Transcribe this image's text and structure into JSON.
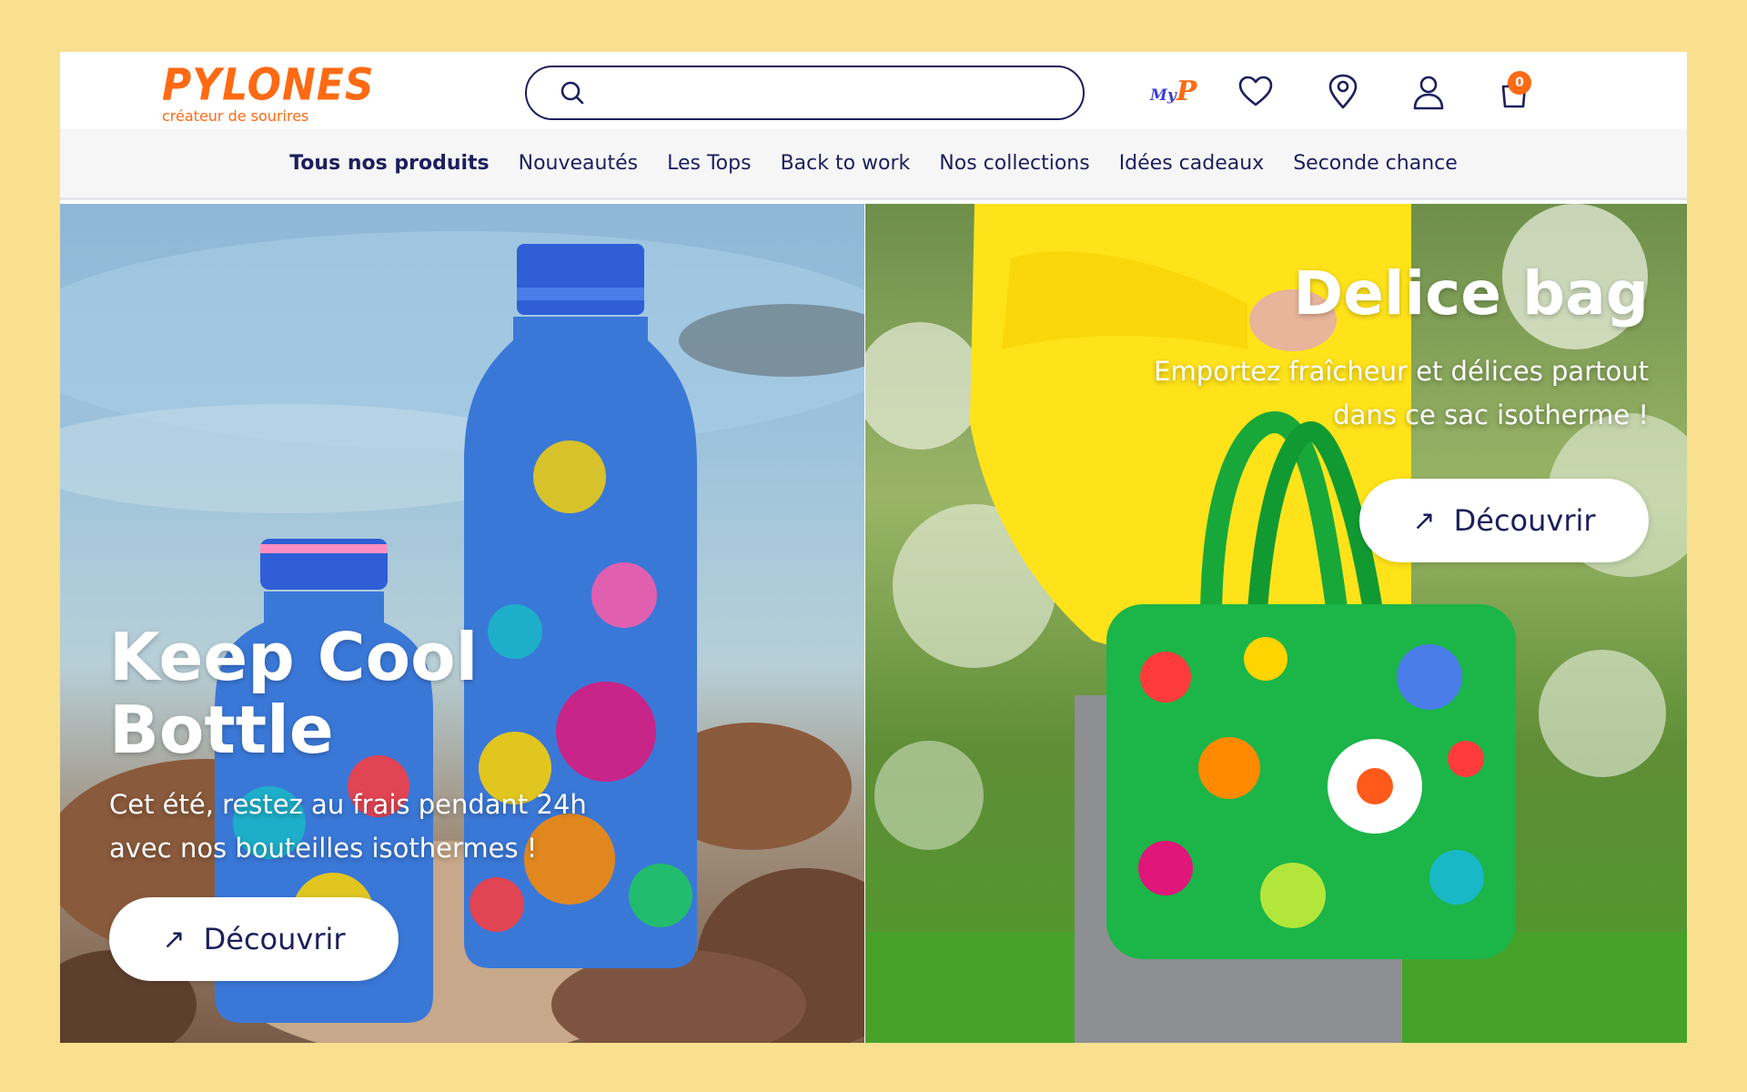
{
  "brand": {
    "name": "PYLONES",
    "tagline": "créateur de sourires",
    "color": "#ff6a13"
  },
  "search": {
    "placeholder": "",
    "value": ""
  },
  "header_icons": {
    "myp_m": "My",
    "myp_p": "P",
    "cart_count": "0",
    "icons": [
      "search-icon",
      "myp-logo",
      "heart-icon",
      "location-icon",
      "user-icon",
      "cart-icon"
    ]
  },
  "nav": {
    "items": [
      {
        "label": "Tous nos produits"
      },
      {
        "label": "Nouveautés"
      },
      {
        "label": "Les Tops"
      },
      {
        "label": "Back to work"
      },
      {
        "label": "Nos collections"
      },
      {
        "label": "Idées cadeaux"
      },
      {
        "label": "Seconde chance"
      }
    ]
  },
  "banners": [
    {
      "title_line1": "Keep Cool",
      "title_line2": "Bottle",
      "subtitle_line1": "Cet été, restez au frais pendant 24h",
      "subtitle_line2": "avec nos bouteilles isothermes !",
      "cta": "Découvrir"
    },
    {
      "title": "Delice bag",
      "subtitle_line1": "Emportez fraîcheur et délices partout",
      "subtitle_line2": "dans ce sac isotherme !",
      "cta": "Découvrir"
    }
  ],
  "colors": {
    "page_background": "#f9e08f",
    "navy": "#1c1f5c",
    "accent": "#ff6a13"
  }
}
